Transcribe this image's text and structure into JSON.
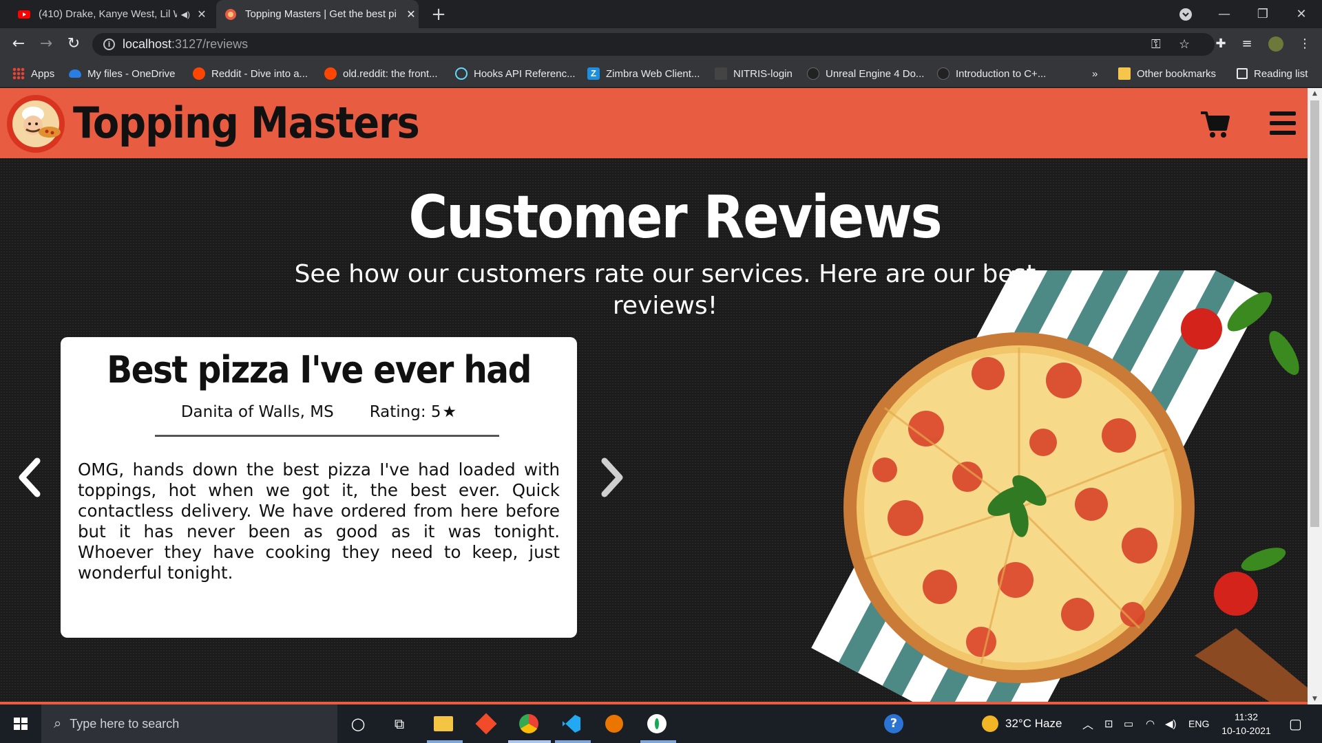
{
  "browser": {
    "tabs": [
      {
        "title": "(410) Drake, Kanye West, Lil W",
        "active": false
      },
      {
        "title": "Topping Masters | Get the best pi",
        "active": true
      }
    ],
    "address": {
      "host": "localhost",
      "path": ":3127/reviews"
    },
    "bookmarks": [
      "Apps",
      "My files - OneDrive",
      "Reddit - Dive into a...",
      "old.reddit: the front...",
      "Hooks API Referenc...",
      "Zimbra Web Client...",
      "NITRIS-login",
      "Unreal Engine 4 Do...",
      "Introduction to C+...",
      "»",
      "Other bookmarks",
      "Reading list"
    ]
  },
  "header": {
    "brand": "Topping Masters"
  },
  "hero": {
    "title": "Customer Reviews",
    "subtitle": "See how our customers rate our services. Here are our best reviews!"
  },
  "review": {
    "title": "Best pizza I've ever had",
    "author": "Danita of Walls, MS",
    "rating_label": "Rating: 5",
    "rating_value": 5,
    "body": "OMG, hands down the best pizza I've had loaded with toppings, hot when we got it, the best ever. Quick contactless delivery. We have ordered from here before but it has never been as good as it was tonight. Whoever they have cooking they need to keep, just wonderful tonight."
  },
  "taskbar": {
    "search_placeholder": "Type here to search",
    "weather": "32°C  Haze",
    "language": "ENG",
    "time": "11:32",
    "date": "10-10-2021"
  },
  "colors": {
    "brand": "#e85c42",
    "page_bg": "#1b1b1b",
    "card_bg": "#ffffff"
  }
}
